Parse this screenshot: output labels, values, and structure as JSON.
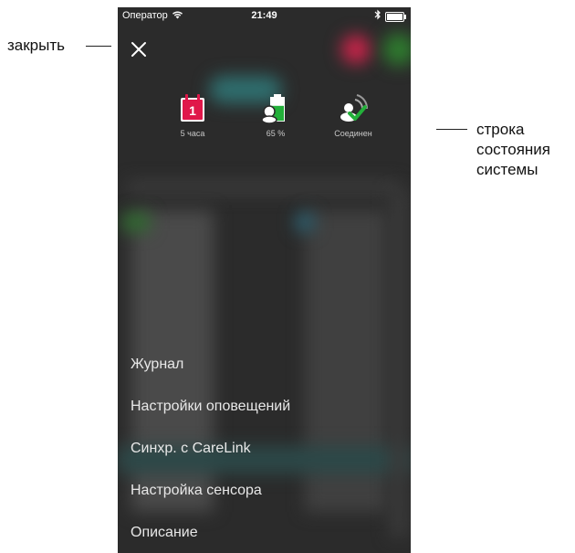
{
  "statusbar": {
    "carrier": "Оператор",
    "time": "21:49"
  },
  "annotations": {
    "close": "закрыть",
    "status_line": "строка",
    "status_line2": "состояния",
    "status_line3": "системы"
  },
  "system_status": [
    {
      "icon": "calendar-icon",
      "label": "5 часа",
      "badge": "1"
    },
    {
      "icon": "pump-battery-icon",
      "label": "65 %",
      "level": 0.65
    },
    {
      "icon": "connection-check-icon",
      "label": "Соединен"
    }
  ],
  "menu": {
    "items": [
      "Журнал",
      "Настройки оповещений",
      "Синхр. с CareLink",
      "Настройка сенсора",
      "Описание"
    ]
  },
  "colors": {
    "calendar": "#e0174a",
    "battery": "#23b03a",
    "check": "#23b03a",
    "overlay": "#2b2b2b"
  }
}
